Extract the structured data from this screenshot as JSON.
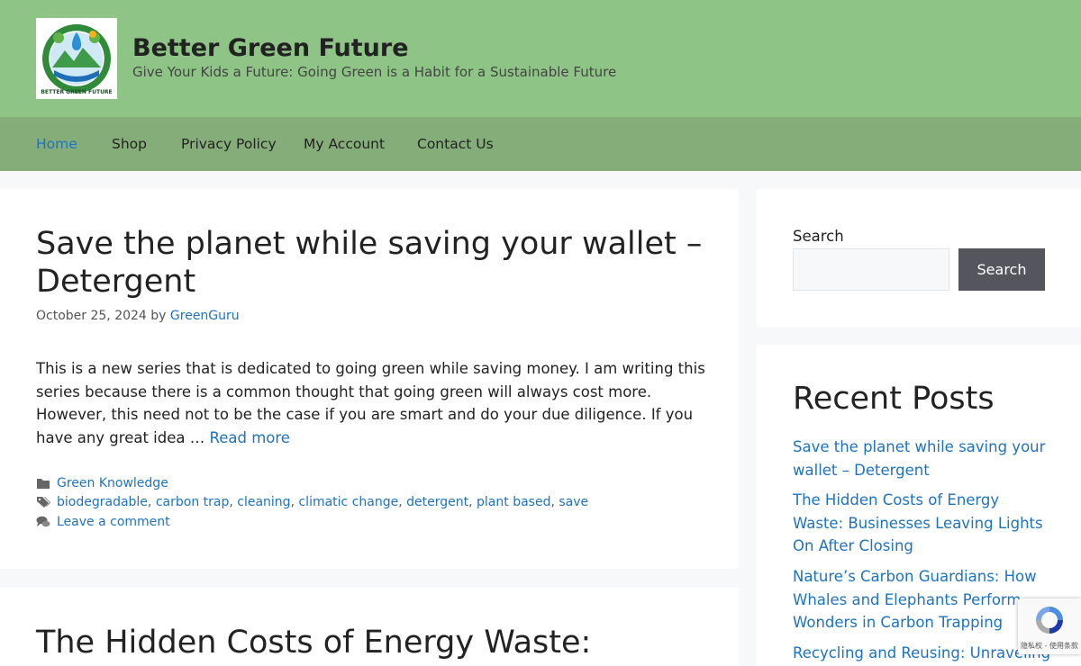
{
  "header": {
    "logo_icon": "better-green-future-logo",
    "logo_text": "BETTER GREEN FUTURE",
    "title": "Better Green Future",
    "tagline": "Give Your Kids a Future: Going Green is a Habit for a Sustainable Future",
    "background_color": "#8ec485"
  },
  "nav": {
    "background_color": "#85ad7a",
    "active_color": "#1e73be",
    "items": [
      {
        "label": "Home",
        "active": true
      },
      {
        "label": "Shop"
      },
      {
        "label": "Privacy Policy"
      },
      {
        "label": "My Account"
      },
      {
        "label": "Contact Us"
      }
    ]
  },
  "posts": [
    {
      "title": "Save the planet while saving your wallet – Detergent",
      "date": "October 25, 2024",
      "by": "by",
      "author": "GreenGuru",
      "excerpt": "This is a new series that is dedicated to going green while saving money. I am writing this series because there is a common thought that going green will always cost more. However, this need not to be the case if you are smart and do your due diligence. If you have any great idea …",
      "read_more": "Read more",
      "category": "Green Knowledge",
      "tags": [
        "biodegradable",
        "carbon trap",
        "cleaning",
        "climatic change",
        "detergent",
        "plant based",
        "save"
      ],
      "comment_link": "Leave a comment"
    },
    {
      "title": "The Hidden Costs of Energy Waste:"
    }
  ],
  "sidebar": {
    "search": {
      "label": "Search",
      "input_value": "",
      "button_label": "Search"
    },
    "recent": {
      "title": "Recent Posts",
      "items": [
        "Save the planet while saving your wallet – Detergent",
        "The Hidden Costs of Energy Waste: Businesses Leaving Lights On After Closing",
        "Nature’s Carbon Guardians: How Whales and Elephants Perform Wonders in Carbon Trapping",
        "Recycling and Reusing: Unraveling"
      ]
    }
  },
  "recaptcha": {
    "icon": "recaptcha-icon",
    "text": "隐私权 - 使用条款"
  }
}
